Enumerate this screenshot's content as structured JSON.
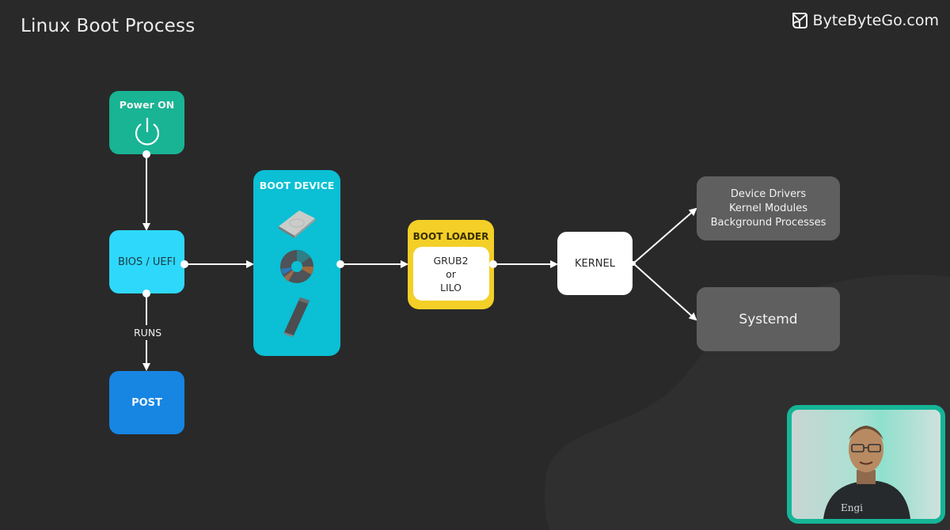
{
  "header": {
    "title": "Linux Boot Process",
    "brand": {
      "name": "ByteByteGo.com",
      "icon": "bytebytego-logo-icon"
    }
  },
  "colors": {
    "background": "#292929",
    "power": "#18b494",
    "bios": "#2ed8fa",
    "post": "#1785e2",
    "boot_device": "#0bbfd4",
    "boot_loader": "#f3cf27",
    "kernel": "#ffffff",
    "gray_node": "#5f5f5f",
    "video_border": "#15b597"
  },
  "nodes": {
    "power": {
      "label": "Power ON",
      "icon": "power-icon"
    },
    "bios": {
      "label": "BIOS / UEFI"
    },
    "post": {
      "label": "POST"
    },
    "boot_device": {
      "label": "BOOT DEVICE",
      "devices": [
        {
          "name": "hard-drive",
          "icon": "hard-drive-icon"
        },
        {
          "name": "optical-disc",
          "icon": "cd-disc-icon"
        },
        {
          "name": "usb-drive",
          "icon": "usb-drive-icon"
        }
      ]
    },
    "boot_loader": {
      "label": "BOOT LOADER",
      "options": [
        "GRUB2",
        "or",
        "LILO"
      ]
    },
    "kernel": {
      "label": "KERNEL"
    },
    "processes": {
      "lines": [
        "Device Drivers",
        "Kernel Modules",
        "Background Processes"
      ]
    },
    "systemd": {
      "label": "Systemd"
    }
  },
  "edges": [
    {
      "from": "power",
      "to": "bios",
      "label": ""
    },
    {
      "from": "bios",
      "to": "post",
      "label": "RUNS"
    },
    {
      "from": "bios",
      "to": "boot_device",
      "label": ""
    },
    {
      "from": "boot_device",
      "to": "boot_loader",
      "label": ""
    },
    {
      "from": "boot_loader",
      "to": "kernel",
      "label": ""
    },
    {
      "from": "kernel",
      "to": "processes",
      "label": ""
    },
    {
      "from": "kernel",
      "to": "systemd",
      "label": ""
    }
  ],
  "video": {
    "description": "presenter webcam overlay",
    "shirt_text": "Engi"
  }
}
